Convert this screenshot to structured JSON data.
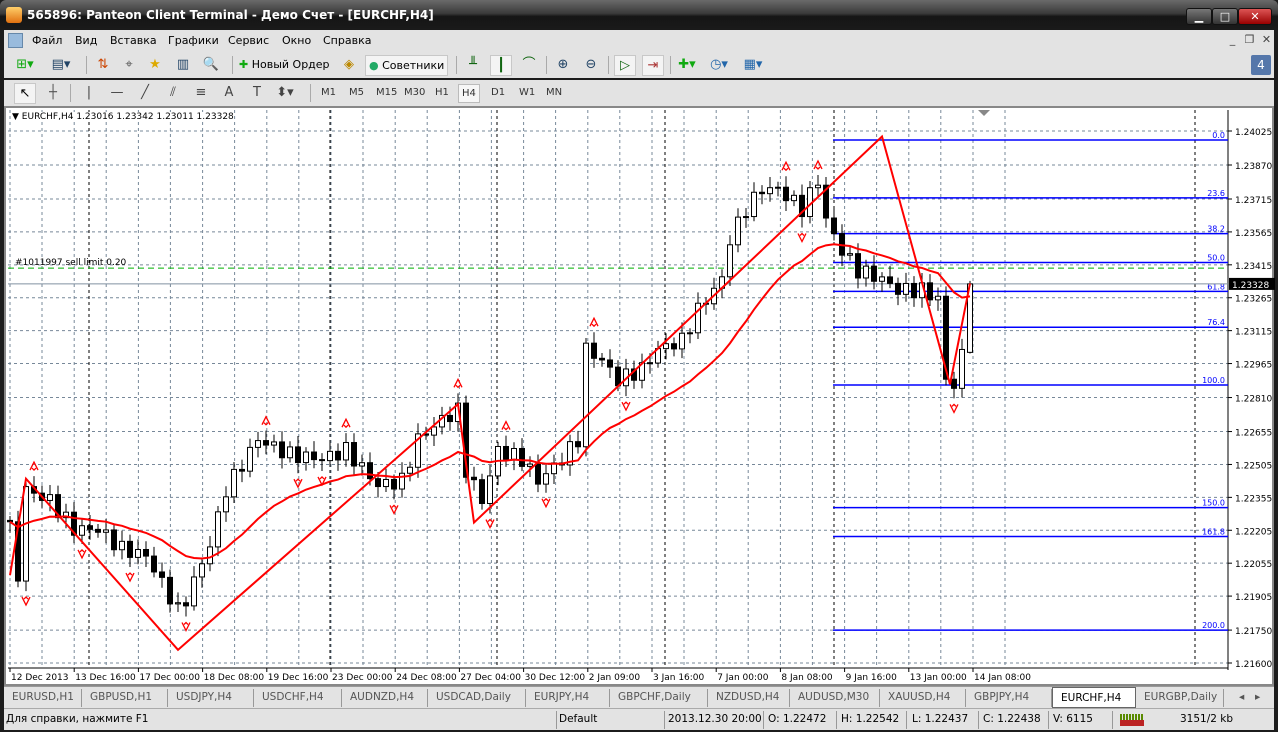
{
  "window": {
    "title": "565896: Panteon Client Terminal - Демо Счет - [EURCHF,H4]",
    "minimize": "▁",
    "maximize": "□",
    "close": "✕"
  },
  "menu": {
    "items": [
      "Файл",
      "Вид",
      "Вставка",
      "Графики",
      "Сервис",
      "Окно",
      "Справка"
    ],
    "mdi": [
      "_",
      "❐",
      "✕"
    ]
  },
  "toolbar": {
    "new_order": "Новый Ордер",
    "experts": "Советники",
    "notifications": "4"
  },
  "timeframes": [
    "M1",
    "M5",
    "M15",
    "M30",
    "H1",
    "H4",
    "D1",
    "W1",
    "MN"
  ],
  "active_timeframe": "H4",
  "chart": {
    "header": "EURCHF,H4  1.23016 1.23342 1.23011 1.23328",
    "order_label": "#1011997 sell limit 0.20",
    "sell_limit_price": 1.234,
    "current_price": "1.23328",
    "colors": {
      "indicator": "#ff0000",
      "fibo": "#0000ff",
      "order": "#00b000",
      "bull": "#ffffff",
      "bear": "#000000",
      "grid": "#778899"
    }
  },
  "chart_data": {
    "type": "candlestick",
    "symbol": "EURCHF",
    "timeframe": "H4",
    "ylim": [
      1.216,
      1.2405
    ],
    "y_ticks": [
      "1.24025",
      "1.23870",
      "1.23715",
      "1.23565",
      "1.23415",
      "1.23265",
      "1.23115",
      "1.22965",
      "1.22810",
      "1.22655",
      "1.22505",
      "1.22355",
      "1.22205",
      "1.22055",
      "1.21905",
      "1.21750",
      "1.21600"
    ],
    "x_ticks": [
      "12 Dec 2013",
      "13 Dec 16:00",
      "17 Dec 00:00",
      "18 Dec 08:00",
      "19 Dec 16:00",
      "23 Dec 00:00",
      "24 Dec 08:00",
      "27 Dec 04:00",
      "30 Dec 12:00",
      "2 Jan 09:00",
      "3 Jan 16:00",
      "7 Jan 00:00",
      "8 Jan 08:00",
      "9 Jan 16:00",
      "13 Jan 00:00",
      "14 Jan 08:00"
    ],
    "close_path": [
      [
        0,
        1.2221
      ],
      [
        1,
        1.22
      ],
      [
        2,
        1.2239
      ],
      [
        5,
        1.2234
      ],
      [
        8,
        1.2221
      ],
      [
        11,
        1.2221
      ],
      [
        14,
        1.2212
      ],
      [
        17,
        1.2209
      ],
      [
        21,
        1.2184
      ],
      [
        22,
        1.2189
      ],
      [
        25,
        1.2214
      ],
      [
        27,
        1.2239
      ],
      [
        31,
        1.2262
      ],
      [
        35,
        1.2255
      ],
      [
        39,
        1.2253
      ],
      [
        42,
        1.2257
      ],
      [
        46,
        1.2241
      ],
      [
        49,
        1.2243
      ],
      [
        51,
        1.2262
      ],
      [
        54,
        1.2271
      ],
      [
        56,
        1.2275
      ],
      [
        57,
        1.2248
      ],
      [
        59,
        1.2234
      ],
      [
        61,
        1.2257
      ],
      [
        64,
        1.2253
      ],
      [
        66,
        1.2243
      ],
      [
        69,
        1.2253
      ],
      [
        71,
        1.2262
      ],
      [
        72,
        1.2303
      ],
      [
        74,
        1.2298
      ],
      [
        76,
        1.2289
      ],
      [
        79,
        1.2294
      ],
      [
        81,
        1.2303
      ],
      [
        84,
        1.2307
      ],
      [
        86,
        1.2321
      ],
      [
        89,
        1.2335
      ],
      [
        90,
        1.2353
      ],
      [
        92,
        1.2367
      ],
      [
        94,
        1.2376
      ],
      [
        96,
        1.2376
      ],
      [
        99,
        1.2367
      ],
      [
        101,
        1.238
      ],
      [
        102,
        1.2362
      ],
      [
        104,
        1.2348
      ],
      [
        106,
        1.2339
      ],
      [
        109,
        1.2335
      ],
      [
        111,
        1.233
      ],
      [
        114,
        1.233
      ],
      [
        116,
        1.2326
      ],
      [
        117,
        1.2289
      ],
      [
        118,
        1.2287
      ],
      [
        119,
        1.23
      ],
      [
        120,
        1.23328
      ]
    ],
    "last_bar": {
      "open": 1.23016,
      "high": 1.23342,
      "low": 1.23011,
      "close": 1.23328
    },
    "zigzag": [
      [
        0,
        1.22
      ],
      [
        2,
        1.2244
      ],
      [
        21,
        1.2166
      ],
      [
        56,
        1.2278
      ],
      [
        58,
        1.2224
      ],
      [
        109,
        1.24
      ],
      [
        117.5,
        1.2287
      ],
      [
        120,
        1.2333
      ]
    ],
    "fibonacci": {
      "high": 1.23984,
      "low": 1.22867,
      "levels": [
        "0.0",
        "23.6",
        "38.2",
        "50.0",
        "61.8",
        "76.4",
        "100.0",
        "150.0",
        "161.8",
        "200.0"
      ]
    }
  },
  "tabs": [
    "EURUSD,H1",
    "GBPUSD,H1",
    "USDJPY,H4",
    "USDCHF,H4",
    "AUDNZD,H4",
    "USDCAD,Daily",
    "EURJPY,H4",
    "GBPCHF,Daily",
    "NZDUSD,H4",
    "AUDUSD,M30",
    "XAUUSD,H4",
    "GBPJPY,H4",
    "EURCHF,H4",
    "EURGBP,Daily"
  ],
  "active_tab": "EURCHF,H4",
  "status": {
    "help": "Для справки, нажмите F1",
    "profile": "Default",
    "time": "2013.12.30 20:00",
    "open": "O: 1.22472",
    "high": "H: 1.22542",
    "low": "L: 1.22437",
    "close": "C: 1.22438",
    "volume": "V: 6115",
    "traffic": "3151/2 kb"
  }
}
